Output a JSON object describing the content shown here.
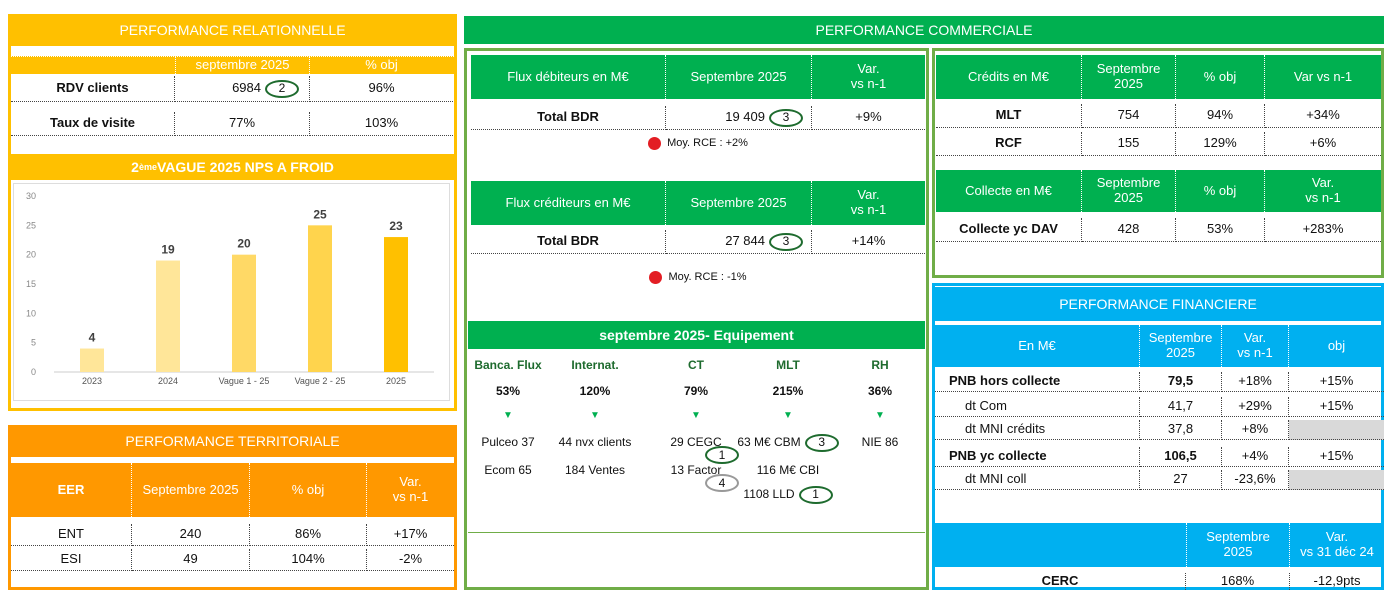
{
  "colors": {
    "yellow": "#ffc000",
    "orange": "#ff9800",
    "green": "#00b050",
    "blue": "#00b0f0"
  },
  "rel": {
    "title": "PERFORMANCE RELATIONNELLE",
    "col_period": "septembre 2025",
    "col_obj": "% obj",
    "rows": [
      {
        "label": "RDV clients",
        "value": "6984",
        "circle": "2",
        "obj": "96%"
      },
      {
        "label": "Taux de visite",
        "value": "77%",
        "obj": "103%"
      }
    ]
  },
  "nps": {
    "title_pre": "2",
    "title_sup": "ème",
    "title_post": " VAGUE 2025 NPS A FROID"
  },
  "chart_data": {
    "type": "bar",
    "categories": [
      "2023",
      "2024",
      "Vague 1 - 25",
      "Vague 2 - 25",
      "2025"
    ],
    "values": [
      4,
      19,
      20,
      25,
      23
    ],
    "ylim": [
      0,
      30
    ],
    "yticks": [
      0,
      5,
      10,
      15,
      20,
      25,
      30
    ],
    "colors": [
      "#ffe699",
      "#ffe699",
      "#ffd966",
      "#ffd44d",
      "#ffc000"
    ]
  },
  "terr": {
    "title": "PERFORMANCE TERRITORIALE",
    "headers": [
      "EER",
      "Septembre 2025",
      "% obj",
      "Var.\nvs n-1"
    ],
    "rows": [
      [
        "ENT",
        "240",
        "86%",
        "+17%"
      ],
      [
        "ESI",
        "49",
        "104%",
        "-2%"
      ]
    ]
  },
  "com": {
    "title": "PERFORMANCE COMMERCIALE",
    "deb": {
      "h1": "Flux débiteurs en M€",
      "h2": "Septembre 2025",
      "h3": "Var.\nvs n-1",
      "label": "Total BDR",
      "value": "19 409",
      "circle": "3",
      "var": "+9%",
      "note": "Moy. RCE : +2%"
    },
    "cred": {
      "h1": "Flux créditeurs en M€",
      "h2": "Septembre 2025",
      "h3": "Var.\nvs n-1",
      "label": "Total BDR",
      "value": "27 844",
      "circle": "3",
      "var": "+14%",
      "note": "Moy. RCE : -1%"
    },
    "equip": {
      "title": "septembre 2025- Equipement",
      "cols": [
        {
          "head": "Banca. Flux",
          "pct": "53%",
          "items": [
            "Pulceo 37",
            "Ecom 65"
          ]
        },
        {
          "head": "Internat.",
          "pct": "120%",
          "items": [
            "44 nvx clients",
            "184 Ventes"
          ]
        },
        {
          "head": "CT",
          "pct": "79%",
          "items": [
            "29 CEGC",
            "13 Factor"
          ]
        },
        {
          "head": "MLT",
          "pct": "215%",
          "items": [
            "63 M€ CBM",
            "116 M€ CBI",
            "1108 LLD"
          ]
        },
        {
          "head": "RH",
          "pct": "36%",
          "items": [
            "NIE 86"
          ]
        }
      ],
      "circles": {
        "ct1": "1",
        "ct2": "4",
        "mlt1": "3",
        "mlt3": "1"
      },
      "arrow": "▼"
    },
    "credits": {
      "h1": "Crédits en M€",
      "h2": "Septembre\n2025",
      "h3": "% obj",
      "h4": "Var vs n-1",
      "rows": [
        [
          "MLT",
          "754",
          "94%",
          "+34%"
        ],
        [
          "RCF",
          "155",
          "129%",
          "+6%"
        ]
      ]
    },
    "collecte": {
      "h1": "Collecte en M€",
      "h2": "Septembre\n2025",
      "h3": "% obj",
      "h4": "Var.\nvs n-1",
      "rows": [
        [
          "Collecte yc DAV",
          "428",
          "53%",
          "+283%"
        ]
      ]
    }
  },
  "fin": {
    "title": "PERFORMANCE FINANCIERE",
    "headers": [
      "En M€",
      "Septembre\n2025",
      "Var.\nvs n-1",
      "obj"
    ],
    "rows": [
      [
        "PNB hors collecte",
        "79,5",
        "+18%",
        "+15%"
      ],
      [
        "dt Com",
        "41,7",
        "+29%",
        "+15%"
      ],
      [
        "dt MNI crédits",
        "37,8",
        "+8%",
        ""
      ],
      [
        "PNB yc collecte",
        "106,5",
        "+4%",
        "+15%"
      ],
      [
        "dt MNI coll",
        "27",
        "-23,6%",
        ""
      ]
    ],
    "cerc": {
      "h1": "Septembre\n2025",
      "h2": "Var.\nvs 31 déc 24",
      "label": "CERC",
      "value": "168%",
      "var": "-12,9pts"
    }
  }
}
